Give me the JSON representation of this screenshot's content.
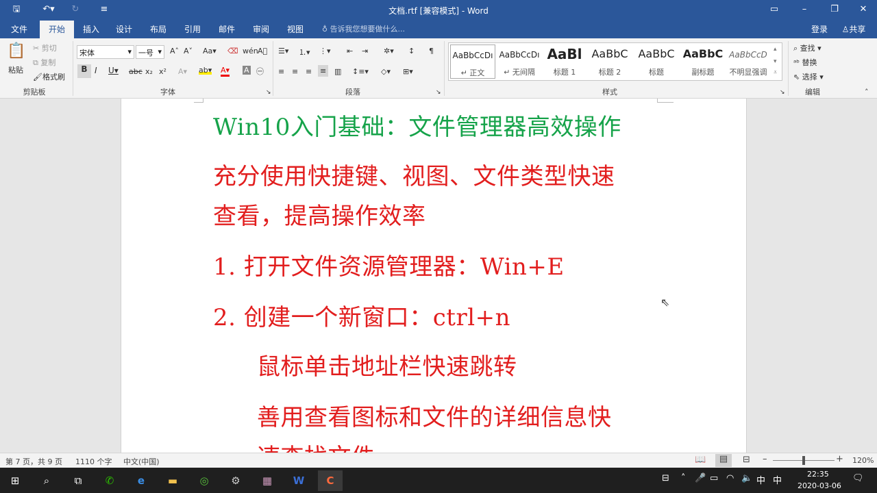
{
  "window": {
    "title": "文档.rtf [兼容模式] - Word"
  },
  "tabs": [
    {
      "label": "文件"
    },
    {
      "label": "开始"
    },
    {
      "label": "插入"
    },
    {
      "label": "设计"
    },
    {
      "label": "布局"
    },
    {
      "label": "引用"
    },
    {
      "label": "邮件"
    },
    {
      "label": "审阅"
    },
    {
      "label": "视图"
    }
  ],
  "active_tab": "开始",
  "tell_me": "告诉我您想要做什么...",
  "account": {
    "login": "登录",
    "share": "共享"
  },
  "ribbon": {
    "clipboard": {
      "paste": "粘贴",
      "cut": "剪切",
      "copy": "复制",
      "format_painter": "格式刷",
      "label": "剪贴板"
    },
    "font": {
      "name": "宋体",
      "size": "一号",
      "label": "字体"
    },
    "paragraph": {
      "label": "段落"
    },
    "styles": {
      "label": "样式",
      "items": [
        {
          "preview": "AaBbCcDı",
          "name": "↵ 正文"
        },
        {
          "preview": "AaBbCcDı",
          "name": "↵ 无间隔"
        },
        {
          "preview": "AaBl",
          "name": "标题 1"
        },
        {
          "preview": "AaBbC",
          "name": "标题 2"
        },
        {
          "preview": "AaBbC",
          "name": "标题"
        },
        {
          "preview": "AaBbC",
          "name": "副标题"
        },
        {
          "preview": "AaBbCcD",
          "name": "不明显强调"
        }
      ]
    },
    "editing": {
      "find": "查找",
      "replace": "替换",
      "select": "选择",
      "label": "编辑"
    }
  },
  "document": {
    "lines": [
      "Win10入门基础：文件管理器高效操作",
      "充分使用快捷键、视图、文件类型快速",
      "查看，提高操作效率",
      "1. 打开文件资源管理器：Win+E",
      "2. 创建一个新窗口：ctrl+n",
      "鼠标单击地址栏快速跳转",
      "善用查看图标和文件的详细信息快",
      "速查找文件"
    ]
  },
  "status": {
    "page": "第 7 页，共 9 页",
    "words": "1110 个字",
    "lang": "中文(中国)",
    "zoom": "120%"
  },
  "taskbar": {
    "time": "22:35",
    "date": "2020-03-06",
    "ime": "中",
    "ime2": "中"
  },
  "colors": {
    "accent": "#2b579a",
    "title_green": "#16a34a",
    "body_red": "#e21e1e"
  }
}
